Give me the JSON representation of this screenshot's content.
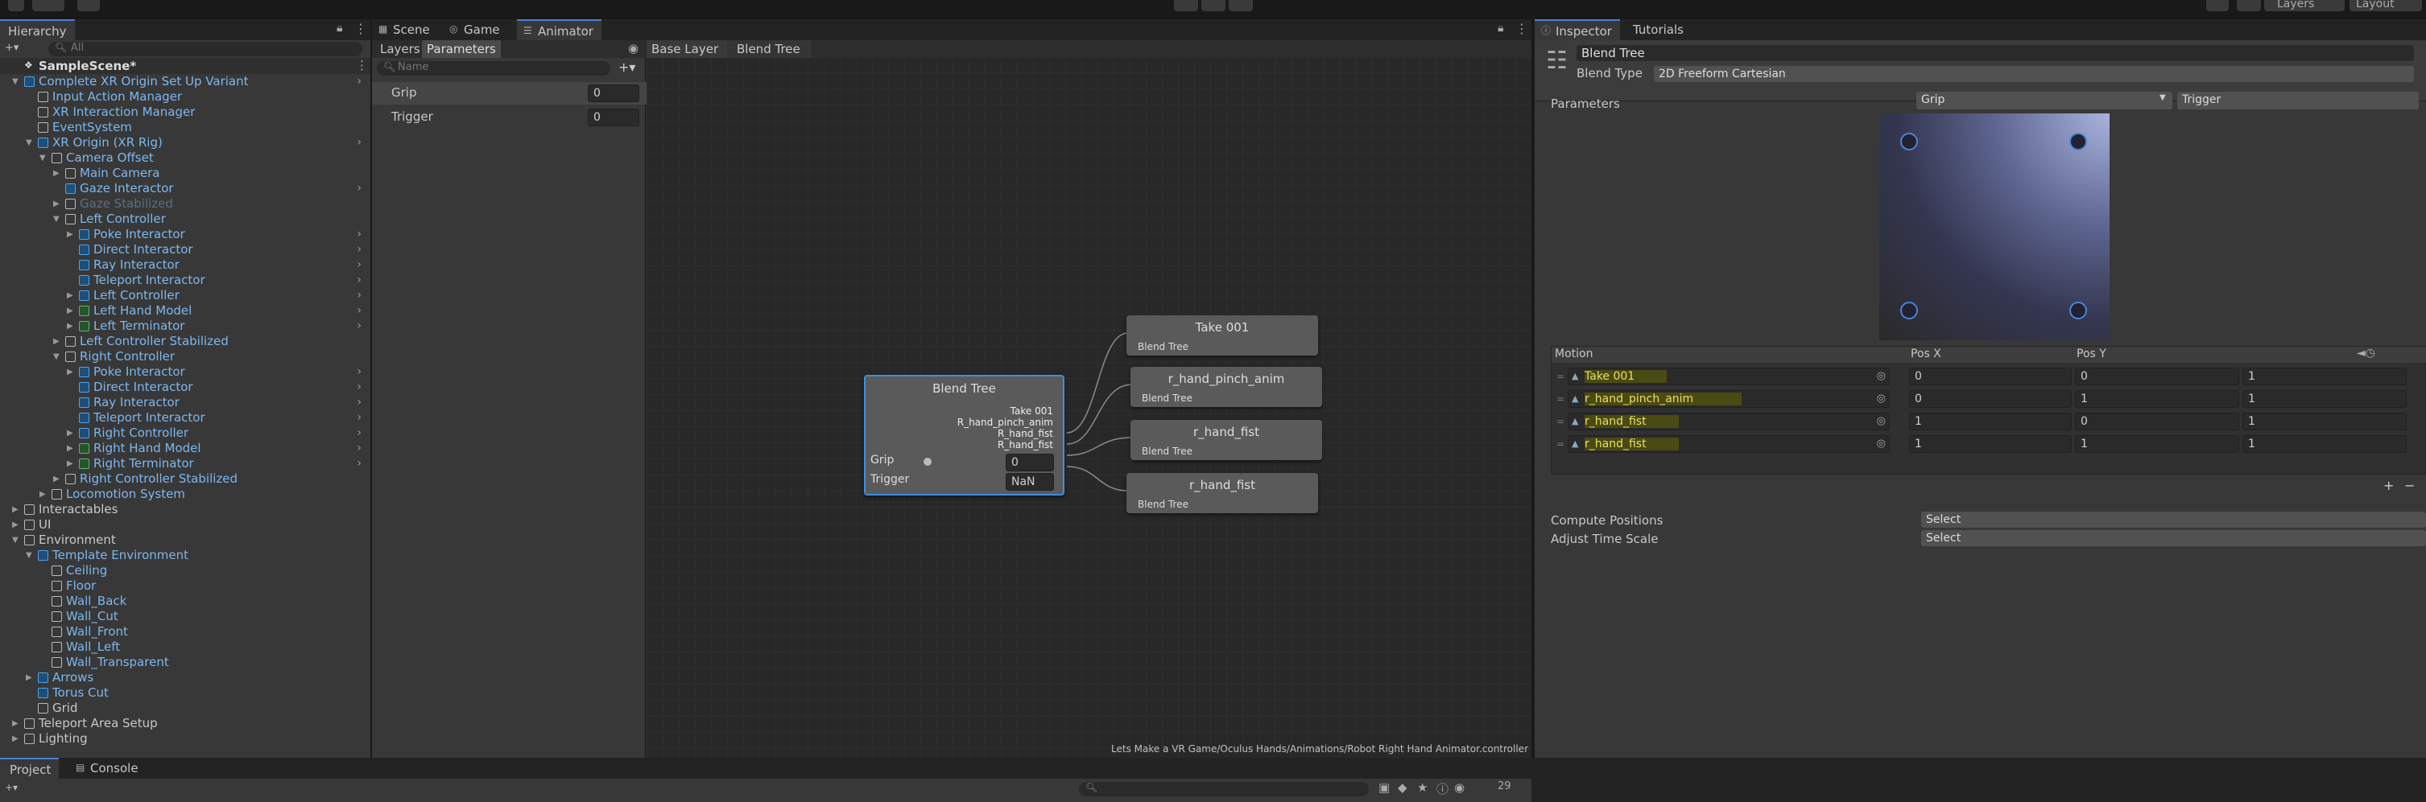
{
  "hierarchy": {
    "tab": "Hierarchy",
    "search_placeholder": "All",
    "scene": "SampleScene*",
    "items": [
      {
        "label": "Complete XR Origin Set Up Variant",
        "depth": 1,
        "icon": "blue",
        "open": true,
        "blue": true,
        "chev": true
      },
      {
        "label": "Input Action Manager",
        "depth": 2,
        "icon": "grey",
        "blue": true
      },
      {
        "label": "XR Interaction Manager",
        "depth": 2,
        "icon": "grey",
        "blue": true
      },
      {
        "label": "EventSystem",
        "depth": 2,
        "icon": "grey",
        "blue": true
      },
      {
        "label": "XR Origin (XR Rig)",
        "depth": 2,
        "icon": "blue",
        "open": true,
        "blue": true,
        "chev": true
      },
      {
        "label": "Camera Offset",
        "depth": 3,
        "icon": "grey",
        "open": true,
        "blue": true
      },
      {
        "label": "Main Camera",
        "depth": 4,
        "icon": "grey",
        "closed": true,
        "blue": true
      },
      {
        "label": "Gaze Interactor",
        "depth": 4,
        "icon": "blue",
        "blue": true,
        "chev": true
      },
      {
        "label": "Gaze Stabilized",
        "depth": 4,
        "icon": "grey",
        "closed": true,
        "dim": true
      },
      {
        "label": "Left Controller",
        "depth": 4,
        "icon": "grey",
        "open": true,
        "blue": true
      },
      {
        "label": "Poke Interactor",
        "depth": 5,
        "icon": "blue",
        "closed": true,
        "blue": true,
        "chev": true
      },
      {
        "label": "Direct Interactor",
        "depth": 5,
        "icon": "blue",
        "blue": true,
        "chev": true
      },
      {
        "label": "Ray Interactor",
        "depth": 5,
        "icon": "blue",
        "blue": true,
        "chev": true
      },
      {
        "label": "Teleport Interactor",
        "depth": 5,
        "icon": "blue",
        "blue": true,
        "chev": true
      },
      {
        "label": "Left Controller",
        "depth": 5,
        "icon": "blue",
        "closed": true,
        "blue": true,
        "chev": true
      },
      {
        "label": "Left Hand Model",
        "depth": 5,
        "icon": "green",
        "closed": true,
        "blue": true,
        "chev": true
      },
      {
        "label": "Left Terminator",
        "depth": 5,
        "icon": "green",
        "closed": true,
        "blue": true,
        "chev": true
      },
      {
        "label": "Left Controller Stabilized",
        "depth": 4,
        "icon": "grey",
        "closed": true,
        "blue": true
      },
      {
        "label": "Right Controller",
        "depth": 4,
        "icon": "grey",
        "open": true,
        "blue": true
      },
      {
        "label": "Poke Interactor",
        "depth": 5,
        "icon": "blue",
        "closed": true,
        "blue": true,
        "chev": true
      },
      {
        "label": "Direct Interactor",
        "depth": 5,
        "icon": "blue",
        "blue": true,
        "chev": true
      },
      {
        "label": "Ray Interactor",
        "depth": 5,
        "icon": "blue",
        "blue": true,
        "chev": true
      },
      {
        "label": "Teleport Interactor",
        "depth": 5,
        "icon": "blue",
        "blue": true,
        "chev": true
      },
      {
        "label": "Right Controller",
        "depth": 5,
        "icon": "blue",
        "closed": true,
        "blue": true,
        "chev": true
      },
      {
        "label": "Right Hand Model",
        "depth": 5,
        "icon": "green",
        "closed": true,
        "blue": true,
        "chev": true
      },
      {
        "label": "Right Terminator",
        "depth": 5,
        "icon": "green",
        "closed": true,
        "blue": true,
        "chev": true
      },
      {
        "label": "Right Controller Stabilized",
        "depth": 4,
        "icon": "grey",
        "closed": true,
        "blue": true
      },
      {
        "label": "Locomotion System",
        "depth": 3,
        "icon": "grey",
        "closed": true,
        "blue": true
      },
      {
        "label": "Interactables",
        "depth": 1,
        "icon": "grey",
        "closed": true
      },
      {
        "label": "UI",
        "depth": 1,
        "icon": "grey",
        "closed": true
      },
      {
        "label": "Environment",
        "depth": 1,
        "icon": "grey",
        "open": true
      },
      {
        "label": "Template Environment",
        "depth": 2,
        "icon": "blue",
        "open": true,
        "blue": true
      },
      {
        "label": "Ceiling",
        "depth": 3,
        "icon": "grey",
        "blue": true
      },
      {
        "label": "Floor",
        "depth": 3,
        "icon": "grey",
        "blue": true
      },
      {
        "label": "Wall_Back",
        "depth": 3,
        "icon": "grey",
        "blue": true
      },
      {
        "label": "Wall_Cut",
        "depth": 3,
        "icon": "grey",
        "blue": true
      },
      {
        "label": "Wall_Front",
        "depth": 3,
        "icon": "grey",
        "blue": true
      },
      {
        "label": "Wall_Left",
        "depth": 3,
        "icon": "grey",
        "blue": true
      },
      {
        "label": "Wall_Transparent",
        "depth": 3,
        "icon": "grey",
        "blue": true
      },
      {
        "label": "Arrows",
        "depth": 2,
        "icon": "blue",
        "closed": true,
        "blue": true
      },
      {
        "label": "Torus Cut",
        "depth": 2,
        "icon": "blue",
        "blue": true
      },
      {
        "label": "Grid",
        "depth": 2,
        "icon": "grey"
      },
      {
        "label": "Teleport Area Setup",
        "depth": 1,
        "icon": "grey",
        "closed": true
      },
      {
        "label": "Lighting",
        "depth": 1,
        "icon": "grey",
        "closed": true
      }
    ]
  },
  "tabs": {
    "scene": "Scene",
    "game": "Game",
    "animator": "Animator"
  },
  "animator": {
    "layers_tab": "Layers",
    "parameters_tab": "Parameters",
    "name_placeholder": "Name",
    "breadcrumb": [
      "Base Layer",
      "Blend Tree"
    ],
    "params": [
      {
        "name": "Grip",
        "value": "0"
      },
      {
        "name": "Trigger",
        "value": "0"
      }
    ],
    "main_node": {
      "title": "Blend Tree",
      "outputs": [
        "Take 001",
        "R_hand_pinch_anim",
        "R_hand_fist",
        "R_hand_fist"
      ],
      "grip_label": "Grip",
      "grip_value": "0",
      "trigger_label": "Trigger",
      "trigger_value": "NaN"
    },
    "child_nodes": [
      {
        "title": "Take 001",
        "sub": "Blend Tree"
      },
      {
        "title": "r_hand_pinch_anim",
        "sub": "Blend Tree"
      },
      {
        "title": "r_hand_fist",
        "sub": "Blend Tree"
      },
      {
        "title": "r_hand_fist",
        "sub": "Blend Tree"
      }
    ],
    "path": "Lets Make a VR Game/Oculus Hands/Animations/Robot Right Hand Animator.controller"
  },
  "inspector": {
    "tab": "Inspector",
    "tutorials_tab": "Tutorials",
    "object_name": "Blend Tree",
    "blend_type_label": "Blend Type",
    "blend_type_value": "2D Freeform Cartesian",
    "parameters_label": "Parameters",
    "param_x": "Grip",
    "param_y": "Trigger",
    "motion_header": {
      "motion": "Motion",
      "posx": "Pos X",
      "posy": "Pos Y"
    },
    "motions": [
      {
        "name": "Take 001",
        "x": "0",
        "y": "0",
        "speed": "1"
      },
      {
        "name": "r_hand_pinch_anim",
        "x": "0",
        "y": "1",
        "speed": "1"
      },
      {
        "name": "r_hand_fist",
        "x": "1",
        "y": "0",
        "speed": "1"
      },
      {
        "name": "r_hand_fist",
        "x": "1",
        "y": "1",
        "speed": "1"
      }
    ],
    "compute_label": "Compute Positions",
    "compute_value": "Select",
    "adjust_label": "Adjust Time Scale",
    "adjust_value": "Select"
  },
  "bottom": {
    "project_tab": "Project",
    "console_tab": "Console",
    "badge_count": "29"
  },
  "top": {
    "layers": "Layers",
    "layout": "Layout"
  },
  "colors": {
    "accent": "#4c7fd6",
    "highlight": "#e8e060",
    "node_select": "#3d8fe0"
  }
}
